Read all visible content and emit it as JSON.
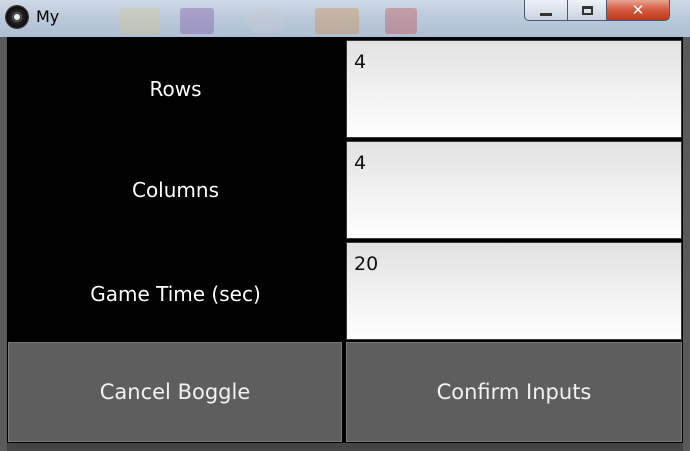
{
  "window": {
    "title": "My",
    "minimize_glyph": "—",
    "close_glyph": "✕"
  },
  "form": {
    "rows_label": "Rows",
    "rows_value": "4",
    "columns_label": "Columns",
    "columns_value": "4",
    "game_time_label": "Game Time (sec)",
    "game_time_value": "20"
  },
  "buttons": {
    "cancel_label": "Cancel Boggle",
    "confirm_label": "Confirm Inputs"
  },
  "colors": {
    "label_panel": "#000000",
    "button_bg": "#5e5e5e",
    "close_button": "#c2381c"
  }
}
